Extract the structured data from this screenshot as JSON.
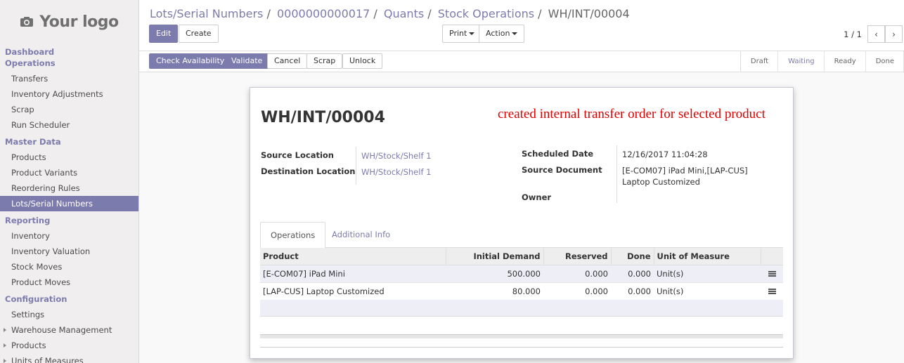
{
  "logo": {
    "text": "Your logo"
  },
  "sidebar": {
    "sections": [
      {
        "title": "Dashboard",
        "items": []
      },
      {
        "title": "Operations",
        "items": [
          "Transfers",
          "Inventory Adjustments",
          "Scrap",
          "Run Scheduler"
        ]
      },
      {
        "title": "Master Data",
        "items": [
          "Products",
          "Product Variants",
          "Reordering Rules",
          "Lots/Serial Numbers"
        ]
      },
      {
        "title": "Reporting",
        "items": [
          "Inventory",
          "Inventory Valuation",
          "Stock Moves",
          "Product Moves"
        ]
      },
      {
        "title": "Configuration",
        "items": [
          "Settings",
          "Warehouse Management",
          "Products",
          "Units of Measures"
        ]
      }
    ]
  },
  "breadcrumb": [
    "Lots/Serial Numbers",
    "0000000000017",
    "Quants",
    "Stock Operations"
  ],
  "breadcrumb_current": "WH/INT/00004",
  "toolbar": {
    "edit": "Edit",
    "create": "Create",
    "print": "Print",
    "action": "Action"
  },
  "pager": {
    "text": "1 / 1",
    "prev": "‹",
    "next": "›"
  },
  "statusbar": {
    "buttons": [
      "Check Availability",
      "Validate",
      "Cancel",
      "Scrap",
      "Unlock"
    ],
    "stages": [
      "Draft",
      "Waiting",
      "Ready",
      "Done"
    ],
    "active_stage": "Waiting"
  },
  "form": {
    "title": "WH/INT/00004",
    "note": "created internal transfer order for selected product",
    "source_location_label": "Source Location",
    "source_location": "WH/Stock/Shelf 1",
    "destination_location_label": "Destination Location",
    "destination_location": "WH/Stock/Shelf 1",
    "scheduled_date_label": "Scheduled Date",
    "scheduled_date": "12/16/2017 11:04:28",
    "source_document_label": "Source Document",
    "source_document_line1": "[E-COM07] iPad Mini,[LAP-CUS]",
    "source_document_line2": "Laptop Customized",
    "owner_label": "Owner"
  },
  "tabs": [
    "Operations",
    "Additional Info"
  ],
  "operations": {
    "headers": [
      "Product",
      "Initial Demand",
      "Reserved",
      "Done",
      "Unit of Measure"
    ],
    "rows": [
      {
        "product": "[E-COM07] iPad Mini",
        "demand": "500.000",
        "reserved": "0.000",
        "done": "0.000",
        "uom": "Unit(s)"
      },
      {
        "product": "[LAP-CUS] Laptop Customized",
        "demand": "80.000",
        "reserved": "0.000",
        "done": "0.000",
        "uom": "Unit(s)"
      }
    ]
  },
  "colors": {
    "accent": "#7c7bad",
    "note": "#e00000",
    "sidebar_bg": "#f0eeee"
  }
}
